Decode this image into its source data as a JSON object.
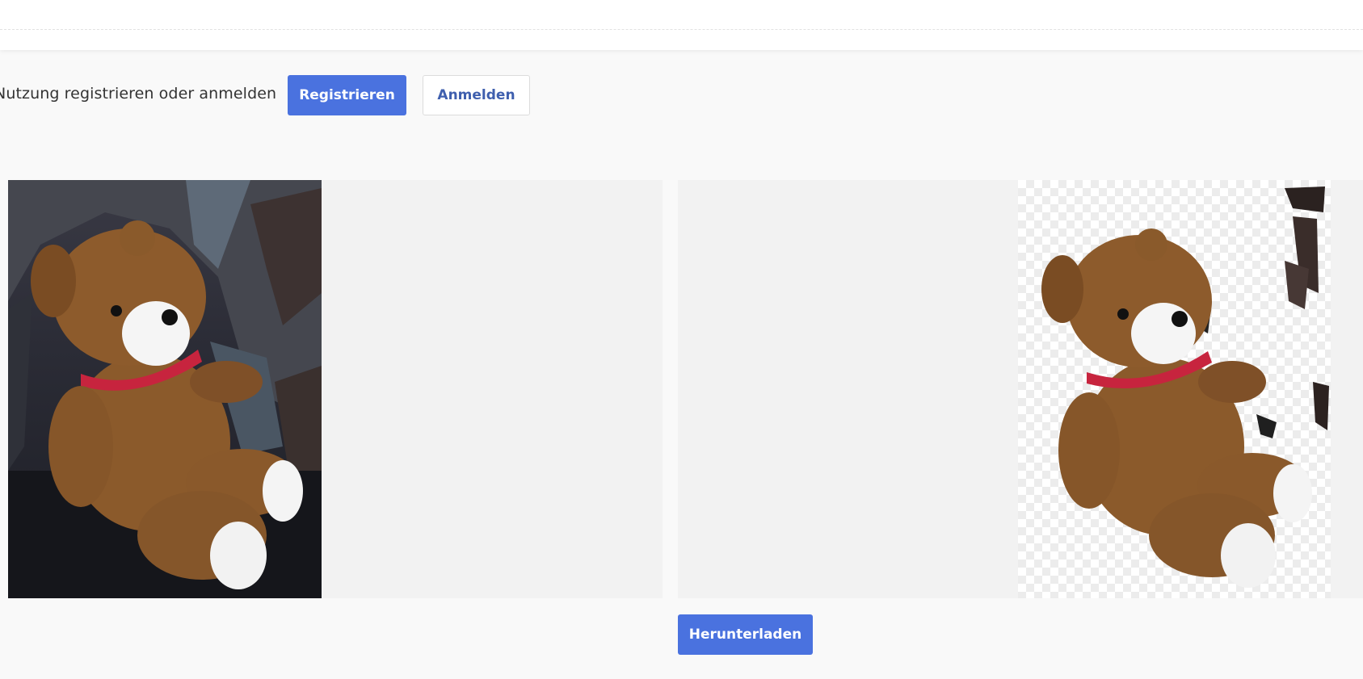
{
  "auth": {
    "prompt_text": "Nutzung registrieren oder anmelden",
    "register_label": "Registrieren",
    "login_label": "Anmelden"
  },
  "download": {
    "label": "Herunterladen"
  },
  "colors": {
    "primary": "#4a72df",
    "outline_text": "#3f5fae",
    "page_background": "#f9f9f9",
    "panel_background": "#f2f2f2"
  },
  "icons": {
    "original_image": "teddy-bear-photo",
    "result_image": "teddy-bear-cutout"
  }
}
